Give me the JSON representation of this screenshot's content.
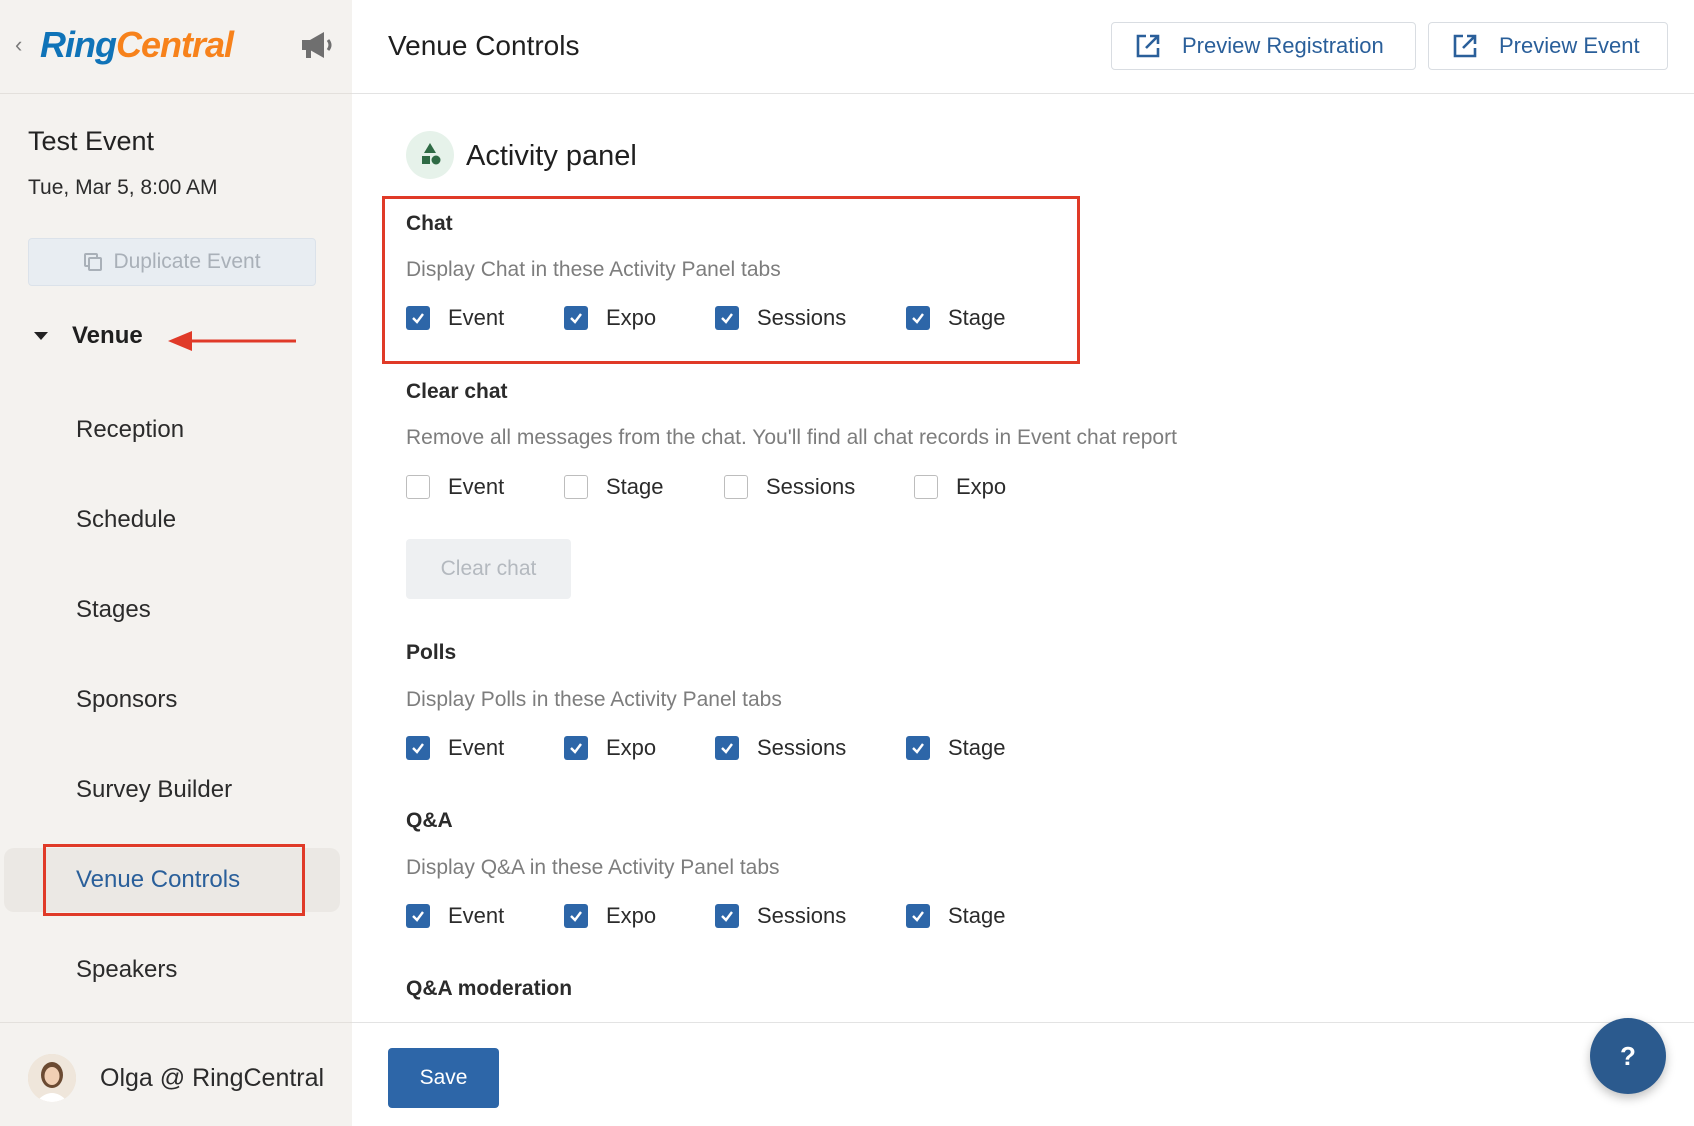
{
  "sidebar": {
    "logo": {
      "part1": "Ring",
      "part2": "Central"
    },
    "event_title": "Test Event",
    "event_date": "Tue, Mar 5, 8:00 AM",
    "duplicate_label": "Duplicate Event",
    "venue_label": "Venue",
    "nav": {
      "reception": "Reception",
      "schedule": "Schedule",
      "stages": "Stages",
      "sponsors": "Sponsors",
      "survey_builder": "Survey Builder",
      "venue_controls": "Venue Controls",
      "speakers": "Speakers"
    },
    "user_name": "Olga @ RingCentral"
  },
  "header": {
    "title": "Venue Controls",
    "preview_registration": "Preview Registration",
    "preview_event": "Preview Event"
  },
  "main": {
    "panel_title": "Activity panel",
    "chat": {
      "title": "Chat",
      "desc": "Display Chat in these Activity Panel tabs",
      "options": [
        {
          "label": "Event",
          "checked": true
        },
        {
          "label": "Expo",
          "checked": true
        },
        {
          "label": "Sessions",
          "checked": true
        },
        {
          "label": "Stage",
          "checked": true
        }
      ]
    },
    "clear_chat": {
      "title": "Clear chat",
      "desc": "Remove all messages from the chat. You'll find all chat records in Event chat report",
      "options": [
        {
          "label": "Event",
          "checked": false
        },
        {
          "label": "Stage",
          "checked": false
        },
        {
          "label": "Sessions",
          "checked": false
        },
        {
          "label": "Expo",
          "checked": false
        }
      ],
      "button": "Clear chat"
    },
    "polls": {
      "title": "Polls",
      "desc": "Display Polls in these Activity Panel tabs",
      "options": [
        {
          "label": "Event",
          "checked": true
        },
        {
          "label": "Expo",
          "checked": true
        },
        {
          "label": "Sessions",
          "checked": true
        },
        {
          "label": "Stage",
          "checked": true
        }
      ]
    },
    "qa": {
      "title": "Q&A",
      "desc": "Display Q&A in these Activity Panel tabs",
      "options": [
        {
          "label": "Event",
          "checked": true
        },
        {
          "label": "Expo",
          "checked": true
        },
        {
          "label": "Sessions",
          "checked": true
        },
        {
          "label": "Stage",
          "checked": true
        }
      ]
    },
    "qa_moderation": {
      "title": "Q&A moderation"
    }
  },
  "footer": {
    "save": "Save",
    "help": "?"
  },
  "colors": {
    "accent": "#2d66a8",
    "annotation": "#e03a28",
    "brand_blue": "#0f73b8",
    "brand_orange": "#f7821b"
  }
}
